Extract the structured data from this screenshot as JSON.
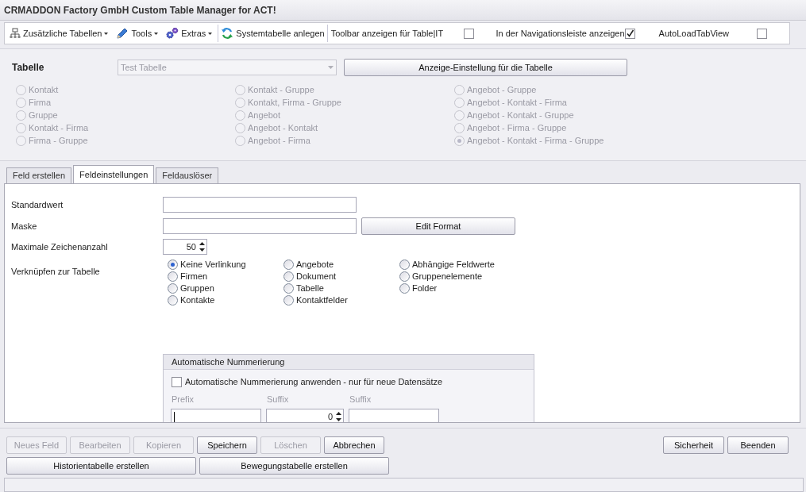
{
  "window": {
    "title": "CRMADDON Factory GmbH Custom Table Manager for ACT!"
  },
  "toolbar": [
    {
      "kind": "menu",
      "label": "Zusätzliche Tabellen"
    },
    {
      "kind": "menu",
      "label": "Tools"
    },
    {
      "kind": "menu",
      "label": "Extras"
    },
    {
      "kind": "button",
      "label": "Systemtabelle anlegen"
    },
    {
      "kind": "checkbox",
      "label": "Toolbar anzeigen für Table|IT",
      "checked": false
    },
    {
      "kind": "checkbox",
      "label": "In der Navigationsleiste anzeigen",
      "checked": true
    },
    {
      "kind": "checkbox",
      "label": "AutoLoadTabView",
      "checked": false
    }
  ],
  "table_selector": {
    "label": "Tabelle",
    "value": "Test Tabelle",
    "disabled": true,
    "button": "Anzeige-Einstellung für die Tabelle"
  },
  "table_types": {
    "disabled": true,
    "columns": [
      [
        {
          "label": "Kontakt",
          "selected": false
        },
        {
          "label": "Firma",
          "selected": false
        },
        {
          "label": "Gruppe",
          "selected": false
        },
        {
          "label": "Kontakt - Firma",
          "selected": false
        },
        {
          "label": "Firma - Gruppe",
          "selected": false
        }
      ],
      [
        {
          "label": "Kontakt - Gruppe",
          "selected": false
        },
        {
          "label": "Kontakt, Firma - Gruppe",
          "selected": false
        },
        {
          "label": "Angebot",
          "selected": false
        },
        {
          "label": "Angebot - Kontakt",
          "selected": false
        },
        {
          "label": "Angebot - Firma",
          "selected": false
        }
      ],
      [
        {
          "label": "Angebot - Gruppe",
          "selected": false
        },
        {
          "label": "Angebot - Kontakt - Firma",
          "selected": false
        },
        {
          "label": "Angebot - Kontakt - Gruppe",
          "selected": false
        },
        {
          "label": "Angebot - Firma - Gruppe",
          "selected": false
        },
        {
          "label": "Angebot - Kontakt - Firma - Gruppe",
          "selected": true
        }
      ]
    ]
  },
  "tabs": [
    {
      "label": "Feld erstellen",
      "selected": false
    },
    {
      "label": "Feldeinstellungen",
      "selected": true
    },
    {
      "label": "Feldauslöser",
      "selected": false
    }
  ],
  "field_settings": {
    "default_value": {
      "label": "Standardwert"
    },
    "mask": {
      "label": "Maske",
      "button": "Edit Format"
    },
    "max_chars": {
      "label": "Maximale Zeichenanzahl",
      "value": "50"
    },
    "link": {
      "label": "Verknüpfen zur Tabelle",
      "columns": [
        [
          {
            "label": "Keine Verlinkung",
            "selected": true
          },
          {
            "label": "Firmen",
            "selected": false
          },
          {
            "label": "Gruppen",
            "selected": false
          },
          {
            "label": "Kontakte",
            "selected": false
          }
        ],
        [
          {
            "label": "Angebote",
            "selected": false
          },
          {
            "label": "Dokument",
            "selected": false
          },
          {
            "label": "Tabelle",
            "selected": false
          },
          {
            "label": "Kontaktfelder",
            "selected": false
          }
        ],
        [
          {
            "label": "Abhängige Feldwerte",
            "selected": false
          },
          {
            "label": "Gruppenelemente",
            "selected": false
          },
          {
            "label": "Folder",
            "selected": false
          }
        ]
      ]
    },
    "auto_numbering": {
      "title": "Automatische Nummerierung",
      "checkbox": {
        "label": "Automatische Nummerierung anwenden - nur für neue Datensätze",
        "checked": false
      },
      "fields": [
        {
          "kind": "text",
          "label": "Prefix",
          "focused": true
        },
        {
          "kind": "spinner",
          "label": "Suffix",
          "value": "0"
        },
        {
          "kind": "text",
          "label": "Suffix"
        }
      ]
    }
  },
  "buttons": [
    {
      "label": "Neues Feld",
      "disabled": true
    },
    {
      "label": "Bearbeiten",
      "disabled": true
    },
    {
      "label": "Kopieren",
      "disabled": true
    },
    {
      "label": "Speichern",
      "disabled": false
    },
    {
      "label": "Löschen",
      "disabled": true
    },
    {
      "label": "Abbrechen",
      "disabled": false
    }
  ],
  "buttons_right": [
    {
      "label": "Sicherheit",
      "disabled": false
    },
    {
      "label": "Beenden",
      "disabled": false
    }
  ],
  "buttons_row2": [
    {
      "label": "Historientabelle erstellen",
      "disabled": false
    },
    {
      "label": "Bewegungstabelle erstellen",
      "disabled": false
    }
  ]
}
